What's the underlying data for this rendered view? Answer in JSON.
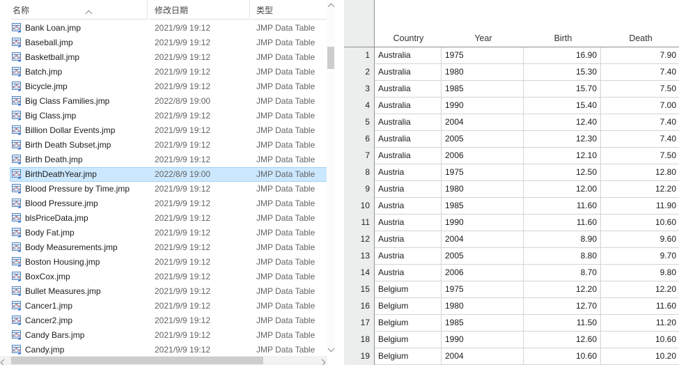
{
  "explorer": {
    "columns": [
      {
        "label": "名称",
        "sorted_ascending": true
      },
      {
        "label": "修改日期"
      },
      {
        "label": "类型"
      }
    ],
    "selected_file": "BirthDeathYear.jmp",
    "files": [
      {
        "name": "Bank Loan.jmp",
        "date": "2021/9/9 19:12",
        "type": "JMP Data Table"
      },
      {
        "name": "Baseball.jmp",
        "date": "2021/9/9 19:12",
        "type": "JMP Data Table"
      },
      {
        "name": "Basketball.jmp",
        "date": "2021/9/9 19:12",
        "type": "JMP Data Table"
      },
      {
        "name": "Batch.jmp",
        "date": "2021/9/9 19:12",
        "type": "JMP Data Table"
      },
      {
        "name": "Bicycle.jmp",
        "date": "2021/9/9 19:12",
        "type": "JMP Data Table"
      },
      {
        "name": "Big Class Families.jmp",
        "date": "2022/8/9 19:00",
        "type": "JMP Data Table"
      },
      {
        "name": "Big Class.jmp",
        "date": "2021/9/9 19:12",
        "type": "JMP Data Table"
      },
      {
        "name": "Billion Dollar Events.jmp",
        "date": "2021/9/9 19:12",
        "type": "JMP Data Table"
      },
      {
        "name": "Birth Death Subset.jmp",
        "date": "2021/9/9 19:12",
        "type": "JMP Data Table"
      },
      {
        "name": "Birth Death.jmp",
        "date": "2021/9/9 19:12",
        "type": "JMP Data Table"
      },
      {
        "name": "BirthDeathYear.jmp",
        "date": "2022/8/9 19:00",
        "type": "JMP Data Table"
      },
      {
        "name": "Blood Pressure by Time.jmp",
        "date": "2021/9/9 19:12",
        "type": "JMP Data Table"
      },
      {
        "name": "Blood Pressure.jmp",
        "date": "2021/9/9 19:12",
        "type": "JMP Data Table"
      },
      {
        "name": "blsPriceData.jmp",
        "date": "2021/9/9 19:12",
        "type": "JMP Data Table"
      },
      {
        "name": "Body Fat.jmp",
        "date": "2021/9/9 19:12",
        "type": "JMP Data Table"
      },
      {
        "name": "Body Measurements.jmp",
        "date": "2021/9/9 19:12",
        "type": "JMP Data Table"
      },
      {
        "name": "Boston Housing.jmp",
        "date": "2021/9/9 19:12",
        "type": "JMP Data Table"
      },
      {
        "name": "BoxCox.jmp",
        "date": "2021/9/9 19:12",
        "type": "JMP Data Table"
      },
      {
        "name": "Bullet Measures.jmp",
        "date": "2021/9/9 19:12",
        "type": "JMP Data Table"
      },
      {
        "name": "Cancer1.jmp",
        "date": "2021/9/9 19:12",
        "type": "JMP Data Table"
      },
      {
        "name": "Cancer2.jmp",
        "date": "2021/9/9 19:12",
        "type": "JMP Data Table"
      },
      {
        "name": "Candy Bars.jmp",
        "date": "2021/9/9 19:12",
        "type": "JMP Data Table"
      },
      {
        "name": "Candy.jmp",
        "date": "2021/9/9 19:12",
        "type": "JMP Data Table"
      }
    ]
  },
  "jmp_table": {
    "columns": {
      "country": "Country",
      "year": "Year",
      "birth": "Birth",
      "death": "Death"
    },
    "rows": [
      {
        "n": "1",
        "country": "Australia",
        "year": "1975",
        "birth": "16.90",
        "death": "7.90"
      },
      {
        "n": "2",
        "country": "Australia",
        "year": "1980",
        "birth": "15.30",
        "death": "7.40"
      },
      {
        "n": "3",
        "country": "Australia",
        "year": "1985",
        "birth": "15.70",
        "death": "7.50"
      },
      {
        "n": "4",
        "country": "Australia",
        "year": "1990",
        "birth": "15.40",
        "death": "7.00"
      },
      {
        "n": "5",
        "country": "Australia",
        "year": "2004",
        "birth": "12.40",
        "death": "7.40"
      },
      {
        "n": "6",
        "country": "Australia",
        "year": "2005",
        "birth": "12.30",
        "death": "7.40"
      },
      {
        "n": "7",
        "country": "Australia",
        "year": "2006",
        "birth": "12.10",
        "death": "7.50"
      },
      {
        "n": "8",
        "country": "Austria",
        "year": "1975",
        "birth": "12.50",
        "death": "12.80"
      },
      {
        "n": "9",
        "country": "Austria",
        "year": "1980",
        "birth": "12.00",
        "death": "12.20"
      },
      {
        "n": "10",
        "country": "Austria",
        "year": "1985",
        "birth": "11.60",
        "death": "11.90"
      },
      {
        "n": "11",
        "country": "Austria",
        "year": "1990",
        "birth": "11.60",
        "death": "10.60"
      },
      {
        "n": "12",
        "country": "Austria",
        "year": "2004",
        "birth": "8.90",
        "death": "9.60"
      },
      {
        "n": "13",
        "country": "Austria",
        "year": "2005",
        "birth": "8.80",
        "death": "9.70"
      },
      {
        "n": "14",
        "country": "Austria",
        "year": "2006",
        "birth": "8.70",
        "death": "9.80"
      },
      {
        "n": "15",
        "country": "Belgium",
        "year": "1975",
        "birth": "12.20",
        "death": "12.20"
      },
      {
        "n": "16",
        "country": "Belgium",
        "year": "1980",
        "birth": "12.70",
        "death": "11.60"
      },
      {
        "n": "17",
        "country": "Belgium",
        "year": "1985",
        "birth": "11.50",
        "death": "11.20"
      },
      {
        "n": "18",
        "country": "Belgium",
        "year": "1990",
        "birth": "12.60",
        "death": "10.60"
      },
      {
        "n": "19",
        "country": "Belgium",
        "year": "2004",
        "birth": "10.60",
        "death": "10.20"
      }
    ]
  },
  "colors": {
    "selection_bg": "#cce8ff",
    "selection_border": "#a3d3f4",
    "row_header_bg": "#eceded",
    "grid_line_light": "#d4d4d4",
    "grid_line_dark": "#8f8f8f",
    "secondary_text": "#636363",
    "icon_blue": "#4a7ebb",
    "icon_red": "#d23c3c"
  }
}
